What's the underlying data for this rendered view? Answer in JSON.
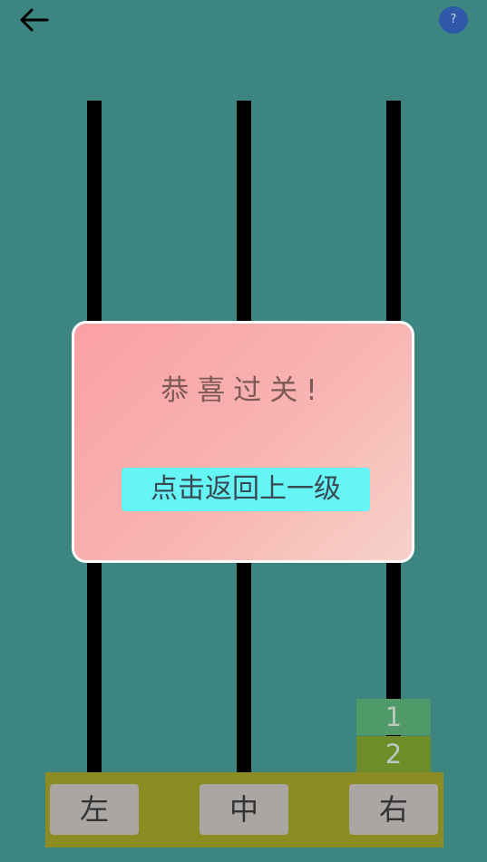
{
  "header": {
    "back_icon": "arrow-left-icon",
    "help_label": "?"
  },
  "towers": {
    "disks_on_right": [
      "1",
      "2"
    ]
  },
  "controls": {
    "left_label": "左",
    "middle_label": "中",
    "right_label": "右"
  },
  "dialog": {
    "title": "恭喜过关!",
    "button_label": "点击返回上一级"
  },
  "colors": {
    "background": "#3d8580",
    "dialog_button": "#65f5f5",
    "base": "#8c8c22"
  }
}
